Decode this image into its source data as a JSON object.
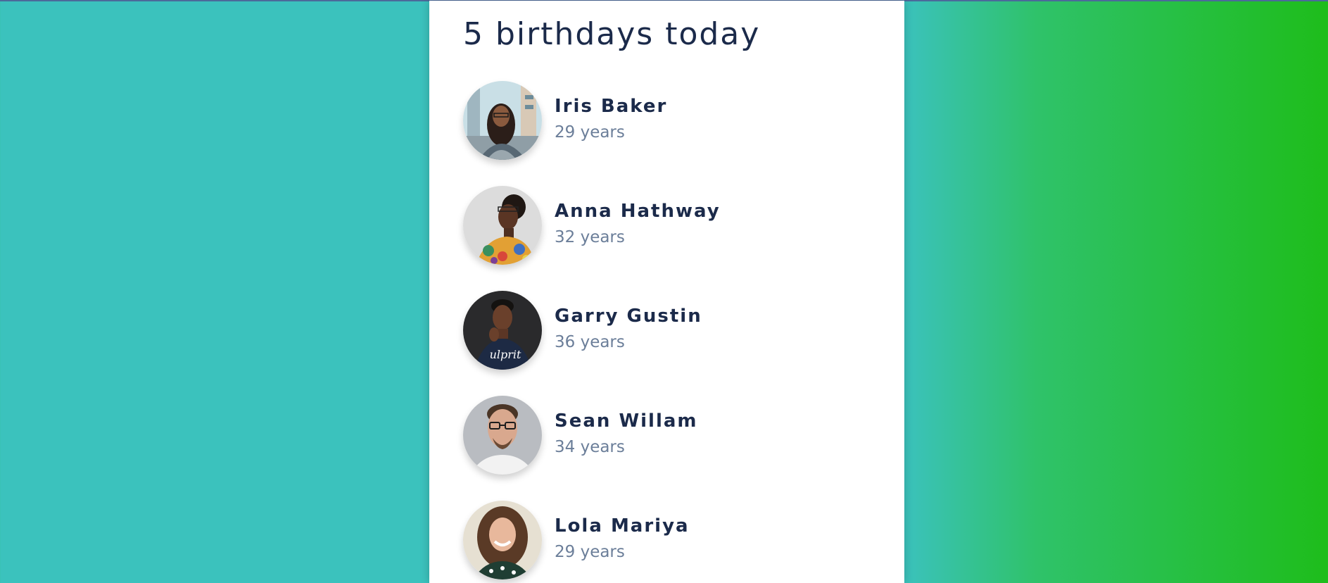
{
  "page": {
    "title": "5 birthdays today",
    "background_colors": [
      "#3bc2bd",
      "#1ebd1b"
    ],
    "title_color": "#1b2a4a",
    "age_color": "#6b7e99"
  },
  "people": [
    {
      "name": "Iris Baker",
      "age": "29 years",
      "avatar": "woman-glasses-street-photo"
    },
    {
      "name": "Anna Hathway",
      "age": "32 years",
      "avatar": "woman-floral-shirt-photo"
    },
    {
      "name": "Garry Gustin",
      "age": "36 years",
      "avatar": "man-dark-shirt-photo"
    },
    {
      "name": "Sean Willam",
      "age": "34 years",
      "avatar": "man-glasses-smiling-photo"
    },
    {
      "name": "Lola Mariya",
      "age": "29 years",
      "avatar": "woman-curly-hair-photo"
    }
  ]
}
